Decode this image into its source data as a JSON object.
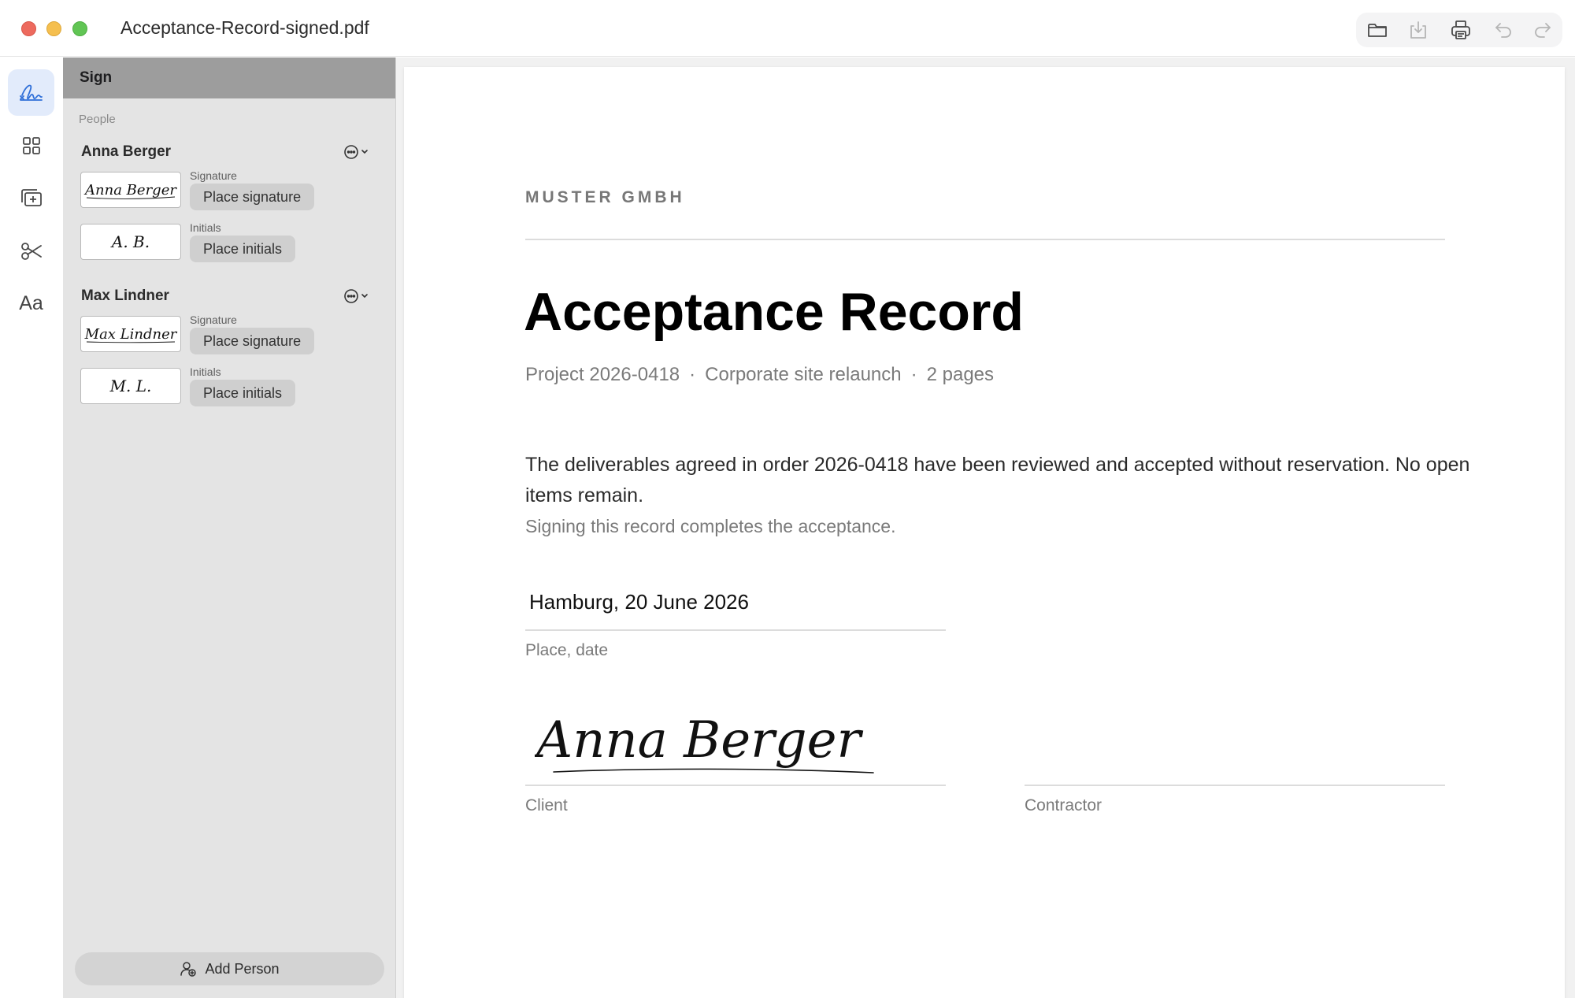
{
  "window": {
    "title": "Acceptance-Record-signed.pdf"
  },
  "toolbar": {
    "icons": [
      "folder-icon",
      "download-icon",
      "print-icon",
      "undo-icon",
      "redo-icon"
    ]
  },
  "rail": {
    "items": [
      "signature-icon",
      "grid-icon",
      "add-page-icon",
      "scissors-icon",
      "text-style-icon"
    ],
    "text_style_label": "Aa"
  },
  "sidebar": {
    "header": "Sign",
    "section_label": "People",
    "people": [
      {
        "name": "Anna Berger",
        "signature_label": "Signature",
        "signature_image_text": "Anna Berger",
        "place_signature": "Place signature",
        "initials_label": "Initials",
        "initials_image_text": "A. B.",
        "place_initials": "Place initials"
      },
      {
        "name": "Max Lindner",
        "signature_label": "Signature",
        "signature_image_text": "Max Lindner",
        "place_signature": "Place signature",
        "initials_label": "Initials",
        "initials_image_text": "M. L.",
        "place_initials": "Place initials"
      }
    ],
    "add_person": "Add Person"
  },
  "document": {
    "company": "MUSTER GMBH",
    "title": "Acceptance Record",
    "meta": {
      "project": "Project 2026-0418",
      "description": "Corporate site relaunch",
      "pages": "2 pages",
      "separator": "·"
    },
    "body": "The deliverables agreed in order 2026-0418 have been reviewed and accepted without reservation. No open items remain.",
    "note": "Signing this record completes the acceptance.",
    "place_date_value": "Hamburg, 20 June 2026",
    "place_date_label": "Place, date",
    "client_signature_text": "Anna Berger",
    "client_label": "Client",
    "contractor_label": "Contractor"
  },
  "colors": {
    "accent": "#2f6fd8",
    "sidebar_bg": "#e4e4e4",
    "sidebar_header": "#9d9d9d",
    "active_rail": "#e2ebfb"
  }
}
